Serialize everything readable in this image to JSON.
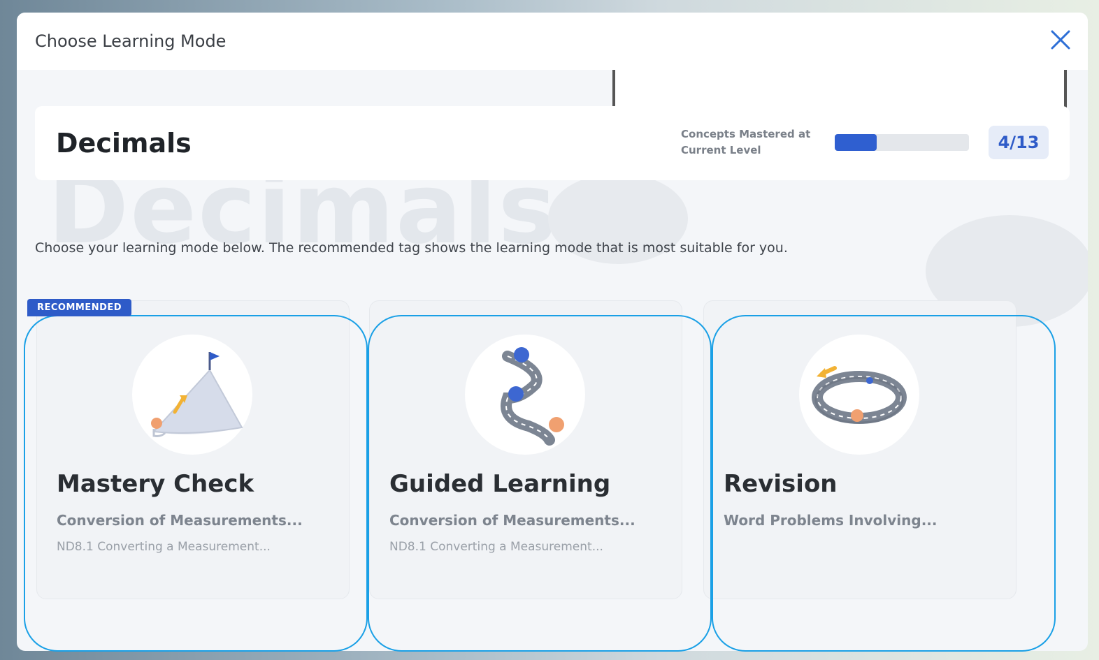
{
  "modal": {
    "title": "Choose Learning Mode",
    "close_icon": "close-icon"
  },
  "topic": {
    "title": "Decimals",
    "mastery_label": "Concepts Mastered at Current Level",
    "progress_value": 0.31,
    "progress_count": "4/13",
    "watermark": "Decimals"
  },
  "instructions": "Choose your learning mode below. The recommended tag shows the learning mode that is most suitable for you.",
  "recommended_tag": "RECOMMENDED",
  "modes": [
    {
      "name": "Mastery Check",
      "subtitle": "Conversion of Measurements...",
      "description": "ND8.1 Converting a Measurement...",
      "icon": "mountain-flag-icon"
    },
    {
      "name": "Guided Learning",
      "subtitle": "Conversion of Measurements...",
      "description": "ND8.1 Converting a Measurement...",
      "icon": "winding-road-icon"
    },
    {
      "name": "Revision",
      "subtitle": "Word Problems Involving...",
      "description": "",
      "icon": "loop-track-icon"
    }
  ],
  "colors": {
    "accent": "#2e5bc8",
    "outline": "#1aa0e6"
  }
}
